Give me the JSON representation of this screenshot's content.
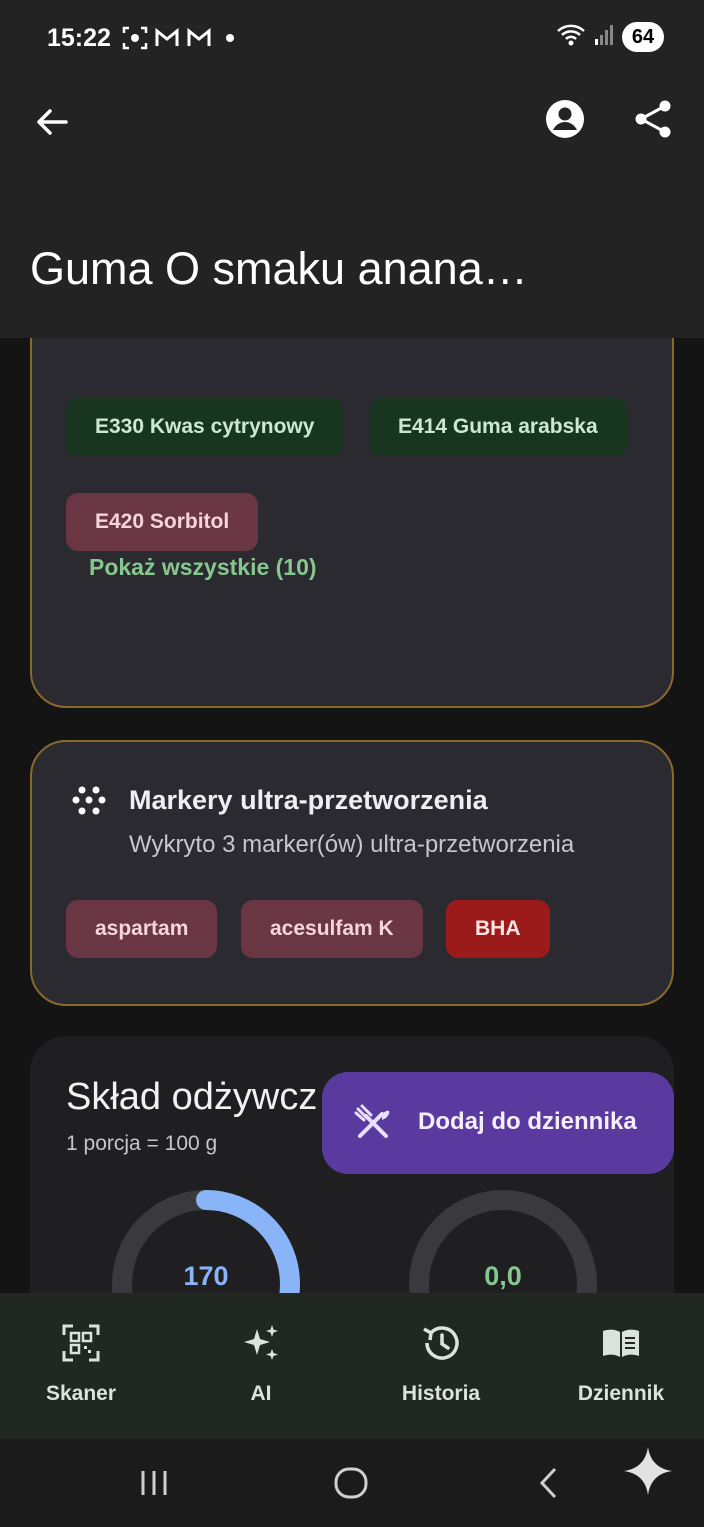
{
  "status_bar": {
    "time": "15:22",
    "battery": "64"
  },
  "header": {
    "title": "Guma O smaku anana…"
  },
  "additives": {
    "chips": [
      {
        "label": "E330 Kwas cytrynowy",
        "kind": "green"
      },
      {
        "label": "E414 Guma arabska",
        "kind": "green"
      },
      {
        "label": "E420 Sorbitol",
        "kind": "pink"
      }
    ],
    "show_all": "Pokaż wszystkie (10)"
  },
  "markers": {
    "title": "Markery ultra-przetworzenia",
    "subtitle": "Wykryto 3 marker(ów) ultra-przetworzenia",
    "chips": [
      {
        "label": "aspartam",
        "kind": "pink"
      },
      {
        "label": "acesulfam K",
        "kind": "pink"
      },
      {
        "label": "BHA",
        "kind": "red"
      }
    ]
  },
  "nutrition": {
    "title": "Skład odżywcz",
    "portion": "1 porcja = 100 g",
    "gauges": [
      {
        "value": "170",
        "fill": 0.3,
        "color": "#8ab4f8"
      },
      {
        "value": "0,0",
        "fill": 0,
        "color": "#86c78e"
      }
    ]
  },
  "fab": {
    "label": "Dodaj do dziennika",
    "icon": "utensils-icon"
  },
  "bottom_nav": {
    "items": [
      {
        "label": "Skaner",
        "icon": "qr-scanner-icon"
      },
      {
        "label": "AI",
        "icon": "sparkles-icon"
      },
      {
        "label": "Historia",
        "icon": "history-icon"
      },
      {
        "label": "Dziennik",
        "icon": "book-icon"
      }
    ]
  },
  "colors": {
    "accent_purple": "#5b3aa0",
    "card_border": "#8a6a2c",
    "chip_green": "#17351f",
    "chip_pink": "#6a3644",
    "chip_red": "#9b1b1b",
    "link_green": "#86c78e"
  }
}
